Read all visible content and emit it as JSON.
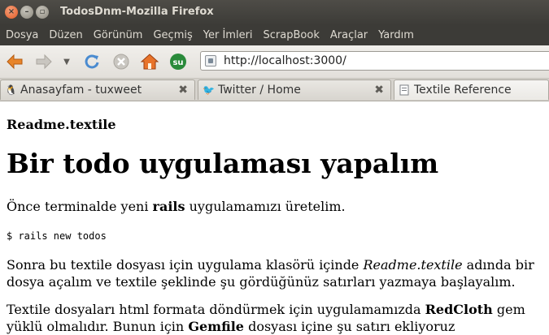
{
  "window": {
    "title": "TodosDnm-Mozilla Firefox"
  },
  "menu": [
    "Dosya",
    "Düzen",
    "Görünüm",
    "Geçmiş",
    "Yer İmleri",
    "ScrapBook",
    "Araçlar",
    "Yardım"
  ],
  "nav": {
    "url": "http://localhost:3000/"
  },
  "tabs": [
    {
      "label": "Anasayfam - tuxweet",
      "icon": "tux-icon",
      "active": false
    },
    {
      "label": "Twitter / Home",
      "icon": "twitter-bird-icon",
      "active": false
    },
    {
      "label": "Textile Reference",
      "icon": "page-icon",
      "active": true
    }
  ],
  "page": {
    "file_heading": "Readme.textile",
    "main_heading": "Bir todo uygulaması yapalım",
    "p1_before": "Önce terminalde yeni ",
    "p1_bold": "rails",
    "p1_after": " uygulamamızı üretelim.",
    "code": "$ rails new todos",
    "p2_before": "Sonra bu textile dosyası için uygulama klasörü içinde ",
    "p2_italic": "Readme.textile",
    "p2_after": " adında bir dosya açalım ve textile şeklinde şu gördüğünüz satırları yazmaya başlayalım.",
    "p3_before": "Textile dosyaları html formata döndürmek için uygulamamızda ",
    "p3_bold": "RedCloth",
    "p3_middle": " gem yüklü olmalıdır. Bunun için ",
    "p3_bold2": "Gemfile",
    "p3_after": " dosyası içine şu satırı ekliyoruz"
  }
}
